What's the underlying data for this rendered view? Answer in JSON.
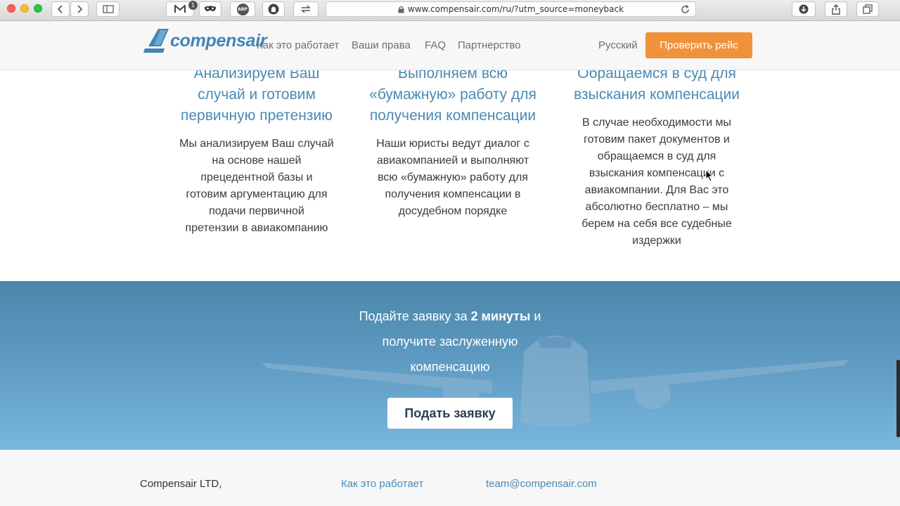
{
  "browser": {
    "url": "www.compensair.com/ru/?utm_source=moneyback",
    "mail_badge": "1",
    "abp_label": "ABP"
  },
  "header": {
    "logo_text": "compensair",
    "nav": [
      "Как это работает",
      "Ваши права",
      "FAQ",
      "Партнерство"
    ],
    "language": "Русский",
    "cta": "Проверить рейс"
  },
  "steps": [
    {
      "title": [
        "Анализируем Ваш",
        "случай и готовим",
        "первичную претензию"
      ],
      "text": [
        "Мы анализируем Ваш случай",
        "на основе нашей",
        "прецедентной базы и",
        "готовим аргументацию для",
        "подачи первичной",
        "претензии в авиакомпанию"
      ]
    },
    {
      "title": [
        "Выполняем всю",
        "«бумажную» работу для",
        "получения компенсации"
      ],
      "text": [
        "Наши юристы ведут диалог с",
        "авиакомпанией и выполняют",
        "всю «бумажную» работу для",
        "получения компенсации в",
        "досудебном порядке"
      ]
    },
    {
      "title": [
        "Обращаемся в суд для",
        "взыскания компенсации"
      ],
      "text": [
        "В случае необходимости мы",
        "готовим пакет документов и",
        "обращаемся в суд для",
        "взыскания компенсации с",
        "авиакомпании. Для Вас это",
        "абсолютно бесплатно – мы",
        "берем на себя все судебные",
        "издержки"
      ]
    }
  ],
  "banner": {
    "line1_before": "Подайте заявку за ",
    "line1_bold": "2 минуты",
    "line1_after": " и",
    "line2": "получите заслуженную",
    "line3": "компенсацию",
    "button": "Подать заявку"
  },
  "footer": {
    "company": "Compensair LTD,",
    "link": "Как это работает",
    "email": "team@compensair.com"
  },
  "colors": {
    "accent": "#f0923a",
    "brand": "#3f86b5",
    "heading": "#4a8ab3"
  }
}
